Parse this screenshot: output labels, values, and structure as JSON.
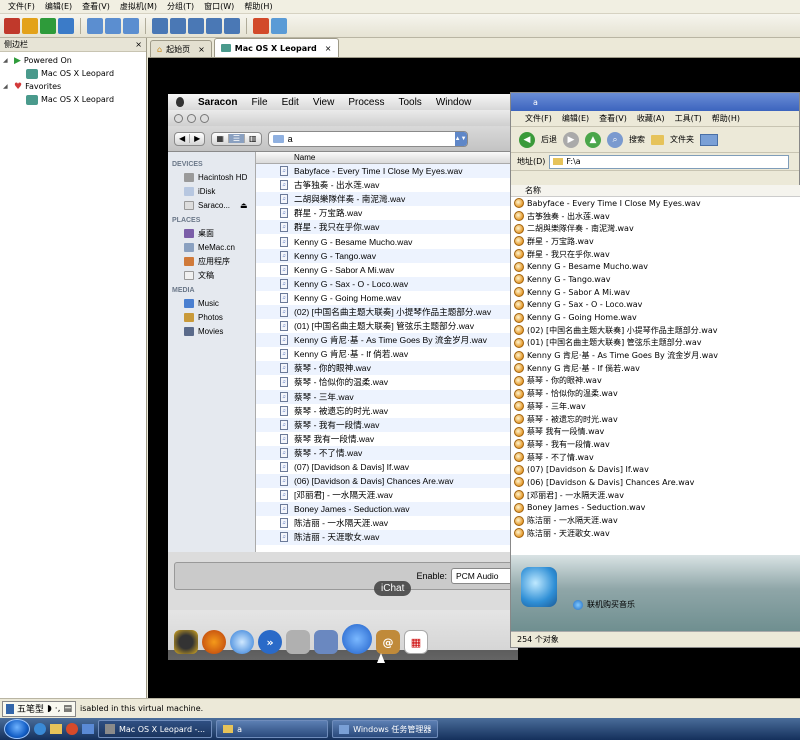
{
  "host_menu": [
    "文件(F)",
    "编辑(E)",
    "查看(V)",
    "虚拟机(M)",
    "分组(T)",
    "窗口(W)",
    "帮助(H)"
  ],
  "sidebar": {
    "title": "侧边栏",
    "close": "×",
    "groups": [
      {
        "label": "Powered On",
        "items": [
          "Mac OS X Leopard"
        ]
      },
      {
        "label": "Favorites",
        "items": [
          "Mac OS X Leopard"
        ]
      }
    ]
  },
  "tabs": [
    {
      "label": "起始页",
      "close": "×"
    },
    {
      "label": "Mac OS X Leopard",
      "close": "×"
    }
  ],
  "mac_menubar": {
    "apple": "",
    "app": "Saracon",
    "items": [
      "File",
      "Edit",
      "View",
      "Process",
      "Tools",
      "Window"
    ]
  },
  "finder": {
    "path": "a",
    "column": "Name",
    "sections": [
      {
        "label": "DEVICES",
        "items": [
          "Hacintosh HD",
          "iDisk",
          "Saraco..."
        ]
      },
      {
        "label": "PLACES",
        "items": [
          "桌面",
          "MeMac.cn",
          "应用程序",
          "文稿"
        ]
      },
      {
        "label": "MEDIA",
        "items": [
          "Music",
          "Photos",
          "Movies"
        ]
      }
    ],
    "files": [
      "Babyface - Every Time I Close My Eyes.wav",
      "古筝独奏 - 出水莲.wav",
      "二胡與樂隊伴奏 - 南泥灣.wav",
      "群星 - 万宝路.wav",
      "群星 - 我只在乎你.wav",
      "Kenny G - Besame Mucho.wav",
      "Kenny G - Tango.wav",
      "Kenny G - Sabor A Mi.wav",
      "Kenny G - Sax - O - Loco.wav",
      "Kenny G - Going Home.wav",
      "(02) [中国名曲主题大联奏] 小提琴作品主题部分.wav",
      "(01) [中国名曲主题大联奏] 管弦乐主题部分.wav",
      "Kenny G 肯尼·基 - As Time Goes By 流金岁月.wav",
      "Kenny G 肯尼·基 - If 倘若.wav",
      "蔡琴 - 你的眼神.wav",
      "蔡琴 - 恰似你的温柔.wav",
      "蔡琴 - 三年.wav",
      "蔡琴 - 被遗忘的时光.wav",
      "蔡琴 - 我有一段情.wav",
      "蔡琴 我有一段情.wav",
      "蔡琴 - 不了情.wav",
      "(07) [Davidson & Davis] If.wav",
      "(06) [Davidson & Davis] Chances Are.wav",
      "[邓丽君] - 一水隔天涯.wav",
      "Boney James - Seduction.wav",
      "陈洁丽 - 一水隔天涯.wav",
      "陈洁丽 - 天涯歌女.wav"
    ],
    "encode_label": "Enable:",
    "encode_value": "PCM Audio"
  },
  "dock_tooltip": "iChat",
  "explorer": {
    "title": "a",
    "menu": [
      "文件(F)",
      "编辑(E)",
      "查看(V)",
      "收藏(A)",
      "工具(T)",
      "帮助(H)"
    ],
    "back": "后退",
    "search": "搜索",
    "folders": "文件夹",
    "address_label": "地址(D)",
    "address": "F:\\a",
    "column": "名称",
    "files": [
      "Babyface - Every Time I Close My Eyes.wav",
      "古筝独奏 - 出水莲.wav",
      "二胡與樂隊伴奏 - 南泥灣.wav",
      "群星 - 万宝路.wav",
      "群星 - 我只在乎你.wav",
      "Kenny G - Besame Mucho.wav",
      "Kenny G - Tango.wav",
      "Kenny G - Sabor A Mi.wav",
      "Kenny G - Sax - O - Loco.wav",
      "Kenny G - Going Home.wav",
      "(02) [中国名曲主题大联奏] 小提琴作品主题部分.wav",
      "(01) [中国名曲主题大联奏] 管弦乐主题部分.wav",
      "Kenny G 肯尼·基 - As Time Goes By 流金岁月.wav",
      "Kenny G 肯尼·基 - If 倘若.wav",
      "蔡琴 - 你的眼神.wav",
      "蔡琴 - 恰似你的温柔.wav",
      "蔡琴 - 三年.wav",
      "蔡琴 - 被遗忘的时光.wav",
      "蔡琴 我有一段情.wav",
      "蔡琴 - 我有一段情.wav",
      "蔡琴 - 不了情.wav",
      "(07) [Davidson & Davis] If.wav",
      "(06) [Davidson & Davis] Chances Are.wav",
      "[邓丽君] - 一水隔天涯.wav",
      "Boney James - Seduction.wav",
      "陈洁丽 - 一水隔天涯.wav",
      "陈洁丽 - 天涯歌女.wav"
    ],
    "preview_link": "联机购买音乐",
    "status": "254 个对象"
  },
  "vm_status": {
    "ime": "五笔型",
    "message": "isabled in this virtual machine."
  },
  "taskbar": {
    "buttons": [
      {
        "label": "Mac OS X Leopard -..."
      },
      {
        "label": "a"
      },
      {
        "label": "Windows 任务管理器"
      }
    ]
  }
}
